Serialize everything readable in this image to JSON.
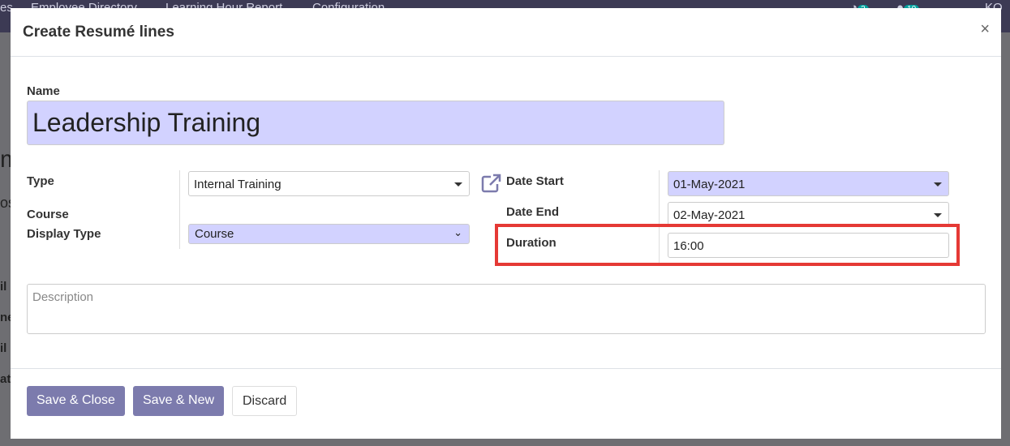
{
  "background": {
    "nav": [
      "es",
      "Employee Directory",
      "Learning Hour Report",
      "Configuration"
    ],
    "badges": [
      "2",
      "10"
    ],
    "user": "KO",
    "side_fragments": [
      "m",
      "os",
      "il",
      "ne",
      "il",
      "at"
    ]
  },
  "dialog": {
    "title": "Create Resumé lines",
    "close": "×",
    "name_label": "Name",
    "name_value": "Leadership Training",
    "type_label": "Type",
    "type_value": "Internal Training",
    "course_label": "Course",
    "display_type_label": "Display Type",
    "display_type_value": "Course",
    "date_start_label": "Date Start",
    "date_start_value": "01-May-2021",
    "date_end_label": "Date End",
    "date_end_value": "02-May-2021",
    "duration_label": "Duration",
    "duration_value": "16:00",
    "description_placeholder": "Description"
  },
  "footer": {
    "save_close": "Save & Close",
    "save_new": "Save & New",
    "discard": "Discard"
  },
  "colors": {
    "primary": "#7c7bad",
    "required_field": "#d2d2ff",
    "highlight": "#e53935"
  }
}
